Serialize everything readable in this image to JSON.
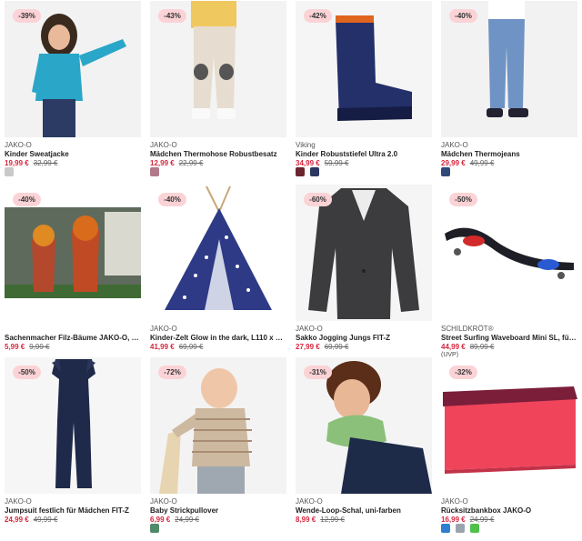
{
  "products": [
    {
      "badge": "-39%",
      "brand": "JAKO-O",
      "title": "Kinder Sweatjacke",
      "price": "19,99 €",
      "old_price": "32,99 €",
      "swatches": [
        {
          "icon": "jacket-swatch-icon",
          "color": "#c9c9c9"
        }
      ]
    },
    {
      "badge": "-43%",
      "brand": "JAKO-O",
      "title": "Mädchen Thermohose Robustbesatz",
      "price": "12,99 €",
      "old_price": "22,99 €",
      "swatches": [
        {
          "icon": "pants-swatch-icon",
          "color": "#b07a8a"
        }
      ]
    },
    {
      "badge": "-42%",
      "brand": "Viking",
      "title": "Kinder Robuststiefel Ultra 2.0",
      "price": "34,99 €",
      "old_price": "59,99 €",
      "swatches": [
        {
          "icon": "boot-swatch-icon",
          "color": "#6b2530"
        },
        {
          "icon": "boot-swatch-icon",
          "color": "#2a3560"
        }
      ]
    },
    {
      "badge": "-40%",
      "brand": "JAKO-O",
      "title": "Mädchen Thermojeans",
      "price": "29,99 €",
      "old_price": "49,99 €",
      "swatches": [
        {
          "icon": "jeans-swatch-icon",
          "color": "#2f4a7a"
        }
      ]
    },
    {
      "badge": "-40%",
      "brand": "",
      "title": "Sachenmacher Filz-Bäume JAKO-O, Ba...",
      "price": "5,99 €",
      "old_price": "9,99 €",
      "swatches": []
    },
    {
      "badge": "-40%",
      "brand": "JAKO-O",
      "title": "Kinder-Zelt Glow in the dark, L110 x B110 x...",
      "price": "41,99 €",
      "old_price": "69,99 €",
      "swatches": []
    },
    {
      "badge": "-60%",
      "brand": "JAKO-O",
      "title": "Sakko Jogging Jungs FIT-Z",
      "price": "27,99 €",
      "old_price": "69,99 €",
      "swatches": []
    },
    {
      "badge": "-50%",
      "brand": "SCHILDKRÖT®",
      "title": "Street Surfing Waveboard Mini SL, für Ki...",
      "price": "44,99 €",
      "old_price": "89,99 €",
      "extra": "(UVP)",
      "swatches": []
    },
    {
      "badge": "-50%",
      "brand": "JAKO-O",
      "title": "Jumpsuit festlich für Mädchen FIT-Z",
      "price": "24,99 €",
      "old_price": "49,99 €",
      "swatches": []
    },
    {
      "badge": "-72%",
      "brand": "JAKO-O",
      "title": "Baby Strickpullover",
      "price": "6,99 €",
      "old_price": "24,99 €",
      "swatches": [
        {
          "icon": "sweater-swatch-icon",
          "color": "#4f8a6a"
        }
      ]
    },
    {
      "badge": "-31%",
      "brand": "JAKO-O",
      "title": "Wende-Loop-Schal, uni-farben",
      "price": "8,99 €",
      "old_price": "12,99 €",
      "swatches": []
    },
    {
      "badge": "-32%",
      "brand": "JAKO-O",
      "title": "Rücksitzbankbox JAKO-O",
      "price": "16,99 €",
      "old_price": "24,99 €",
      "swatches": [
        {
          "icon": "box-swatch-icon",
          "color": "#2f7fd0"
        },
        {
          "icon": "box-swatch-icon",
          "color": "#9aa3ad"
        },
        {
          "icon": "box-swatch-icon",
          "color": "#4fc04a"
        }
      ]
    }
  ]
}
